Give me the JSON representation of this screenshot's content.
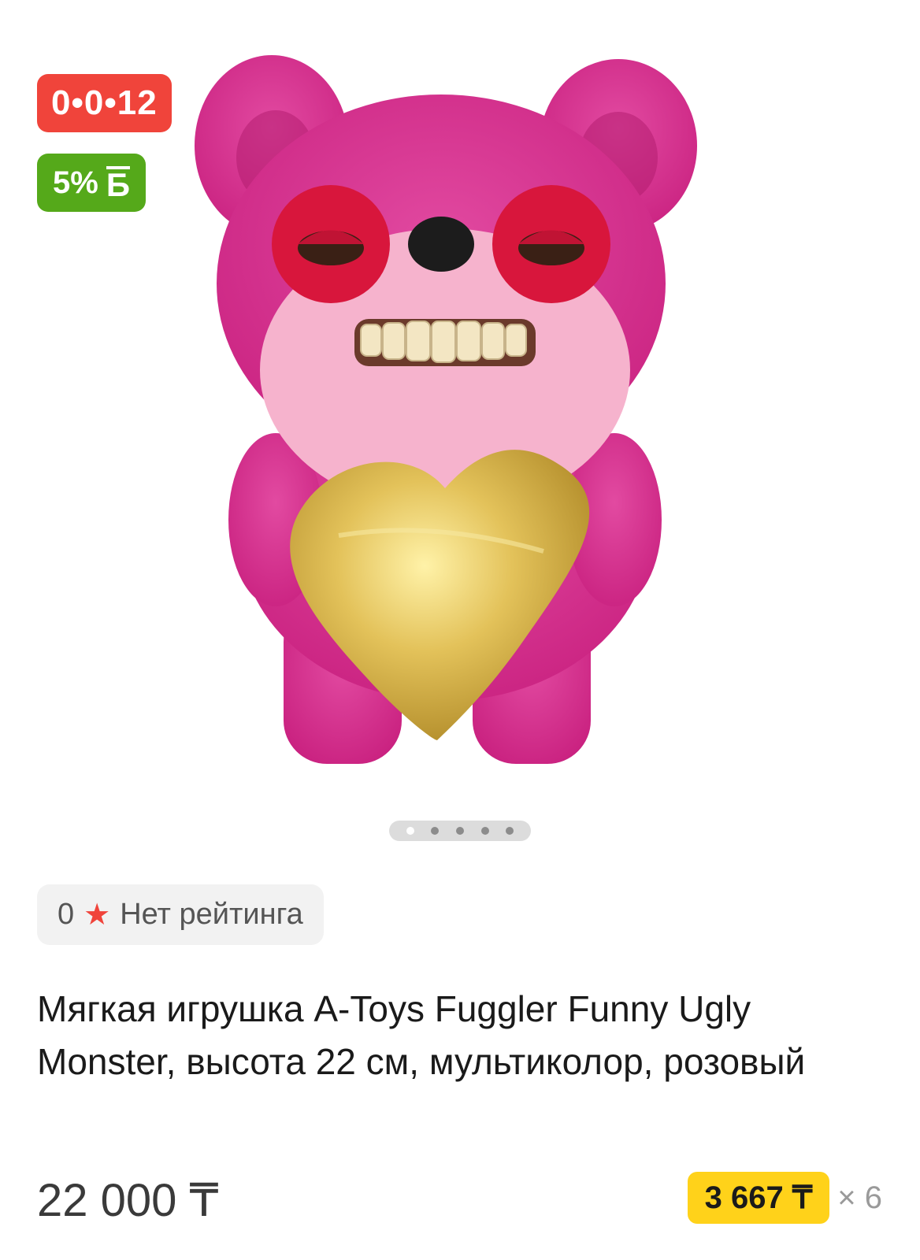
{
  "badges": {
    "timer": "0•0•12",
    "bonus_percent": "5%",
    "bonus_icon_glyph": "Б"
  },
  "gallery": {
    "image_count": 5,
    "active_index": 0
  },
  "rating": {
    "value": "0",
    "label": "Нет рейтинга"
  },
  "product": {
    "title": "Мягкая игрушка A-Toys Fuggler Funny Ugly Monster, высота 22 см, мультиколор, розовый"
  },
  "price": {
    "value": "22 000 ₸",
    "installment_amount": "3 667 ₸",
    "installment_months": "× 6"
  },
  "colors": {
    "timer_badge": "#f0443b",
    "bonus_badge": "#55a91a",
    "installment_highlight": "#ffd21a",
    "star": "#f0443b"
  }
}
